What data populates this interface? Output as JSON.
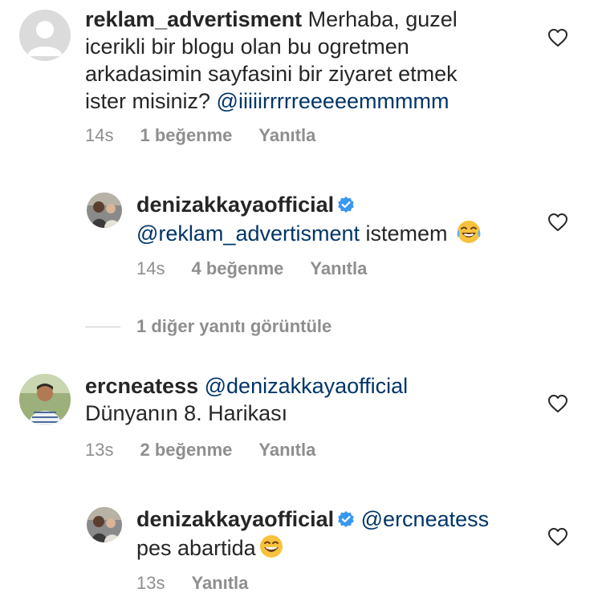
{
  "comments": [
    {
      "username": "reklam_advertisment",
      "lines": [
        "Merhaba, guzel",
        "icerikli bir blogu olan bu ogretmen",
        "arkadasimin sayfasini bir ziyaret etmek",
        "ister misiniz?"
      ],
      "mention": "@iiiiirrrrreeeeemmmmm",
      "time": "14s",
      "likes": "1 beğenme",
      "reply": "Yanıtla",
      "avatar": "default-avatar-icon"
    },
    {
      "username": "denizakkayaofficial",
      "mention": "@reklam_advertisment",
      "text": "istemem",
      "emoji": "tears-of-joy-emoji",
      "time": "14s",
      "likes": "4 beğenme",
      "reply": "Yanıtla",
      "verified": true
    },
    {
      "username": "ercneatess",
      "mention": "@denizakkayaofficial",
      "text": "Dünyanın 8. Harikası",
      "time": "13s",
      "likes": "2 beğenme",
      "reply": "Yanıtla"
    },
    {
      "username": "denizakkayaofficial",
      "mention": "@ercneatess",
      "text": "pes abartida",
      "emoji": "grinning-face-emoji",
      "time": "13s",
      "reply": "Yanıtla",
      "verified": true
    }
  ],
  "view_more_replies": "1 diğer yanıtı görüntüle",
  "colors": {
    "text": "#262626",
    "meta": "#8e8e8e",
    "mention": "#003569",
    "verified": "#3897f0"
  }
}
